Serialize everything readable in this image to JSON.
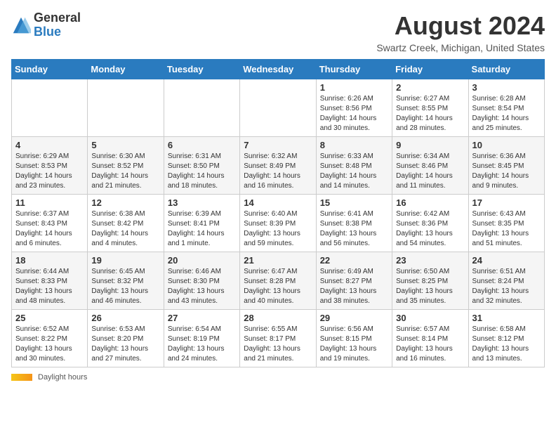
{
  "header": {
    "logo": {
      "general": "General",
      "blue": "Blue"
    },
    "title": "August 2024",
    "location": "Swartz Creek, Michigan, United States"
  },
  "calendar": {
    "days_of_week": [
      "Sunday",
      "Monday",
      "Tuesday",
      "Wednesday",
      "Thursday",
      "Friday",
      "Saturday"
    ],
    "weeks": [
      [
        {
          "day": "",
          "info": ""
        },
        {
          "day": "",
          "info": ""
        },
        {
          "day": "",
          "info": ""
        },
        {
          "day": "",
          "info": ""
        },
        {
          "day": "1",
          "info": "Sunrise: 6:26 AM\nSunset: 8:56 PM\nDaylight: 14 hours and 30 minutes."
        },
        {
          "day": "2",
          "info": "Sunrise: 6:27 AM\nSunset: 8:55 PM\nDaylight: 14 hours and 28 minutes."
        },
        {
          "day": "3",
          "info": "Sunrise: 6:28 AM\nSunset: 8:54 PM\nDaylight: 14 hours and 25 minutes."
        }
      ],
      [
        {
          "day": "4",
          "info": "Sunrise: 6:29 AM\nSunset: 8:53 PM\nDaylight: 14 hours and 23 minutes."
        },
        {
          "day": "5",
          "info": "Sunrise: 6:30 AM\nSunset: 8:52 PM\nDaylight: 14 hours and 21 minutes."
        },
        {
          "day": "6",
          "info": "Sunrise: 6:31 AM\nSunset: 8:50 PM\nDaylight: 14 hours and 18 minutes."
        },
        {
          "day": "7",
          "info": "Sunrise: 6:32 AM\nSunset: 8:49 PM\nDaylight: 14 hours and 16 minutes."
        },
        {
          "day": "8",
          "info": "Sunrise: 6:33 AM\nSunset: 8:48 PM\nDaylight: 14 hours and 14 minutes."
        },
        {
          "day": "9",
          "info": "Sunrise: 6:34 AM\nSunset: 8:46 PM\nDaylight: 14 hours and 11 minutes."
        },
        {
          "day": "10",
          "info": "Sunrise: 6:36 AM\nSunset: 8:45 PM\nDaylight: 14 hours and 9 minutes."
        }
      ],
      [
        {
          "day": "11",
          "info": "Sunrise: 6:37 AM\nSunset: 8:43 PM\nDaylight: 14 hours and 6 minutes."
        },
        {
          "day": "12",
          "info": "Sunrise: 6:38 AM\nSunset: 8:42 PM\nDaylight: 14 hours and 4 minutes."
        },
        {
          "day": "13",
          "info": "Sunrise: 6:39 AM\nSunset: 8:41 PM\nDaylight: 14 hours and 1 minute."
        },
        {
          "day": "14",
          "info": "Sunrise: 6:40 AM\nSunset: 8:39 PM\nDaylight: 13 hours and 59 minutes."
        },
        {
          "day": "15",
          "info": "Sunrise: 6:41 AM\nSunset: 8:38 PM\nDaylight: 13 hours and 56 minutes."
        },
        {
          "day": "16",
          "info": "Sunrise: 6:42 AM\nSunset: 8:36 PM\nDaylight: 13 hours and 54 minutes."
        },
        {
          "day": "17",
          "info": "Sunrise: 6:43 AM\nSunset: 8:35 PM\nDaylight: 13 hours and 51 minutes."
        }
      ],
      [
        {
          "day": "18",
          "info": "Sunrise: 6:44 AM\nSunset: 8:33 PM\nDaylight: 13 hours and 48 minutes."
        },
        {
          "day": "19",
          "info": "Sunrise: 6:45 AM\nSunset: 8:32 PM\nDaylight: 13 hours and 46 minutes."
        },
        {
          "day": "20",
          "info": "Sunrise: 6:46 AM\nSunset: 8:30 PM\nDaylight: 13 hours and 43 minutes."
        },
        {
          "day": "21",
          "info": "Sunrise: 6:47 AM\nSunset: 8:28 PM\nDaylight: 13 hours and 40 minutes."
        },
        {
          "day": "22",
          "info": "Sunrise: 6:49 AM\nSunset: 8:27 PM\nDaylight: 13 hours and 38 minutes."
        },
        {
          "day": "23",
          "info": "Sunrise: 6:50 AM\nSunset: 8:25 PM\nDaylight: 13 hours and 35 minutes."
        },
        {
          "day": "24",
          "info": "Sunrise: 6:51 AM\nSunset: 8:24 PM\nDaylight: 13 hours and 32 minutes."
        }
      ],
      [
        {
          "day": "25",
          "info": "Sunrise: 6:52 AM\nSunset: 8:22 PM\nDaylight: 13 hours and 30 minutes."
        },
        {
          "day": "26",
          "info": "Sunrise: 6:53 AM\nSunset: 8:20 PM\nDaylight: 13 hours and 27 minutes."
        },
        {
          "day": "27",
          "info": "Sunrise: 6:54 AM\nSunset: 8:19 PM\nDaylight: 13 hours and 24 minutes."
        },
        {
          "day": "28",
          "info": "Sunrise: 6:55 AM\nSunset: 8:17 PM\nDaylight: 13 hours and 21 minutes."
        },
        {
          "day": "29",
          "info": "Sunrise: 6:56 AM\nSunset: 8:15 PM\nDaylight: 13 hours and 19 minutes."
        },
        {
          "day": "30",
          "info": "Sunrise: 6:57 AM\nSunset: 8:14 PM\nDaylight: 13 hours and 16 minutes."
        },
        {
          "day": "31",
          "info": "Sunrise: 6:58 AM\nSunset: 8:12 PM\nDaylight: 13 hours and 13 minutes."
        }
      ]
    ]
  },
  "footer": {
    "daylight_label": "Daylight hours"
  }
}
